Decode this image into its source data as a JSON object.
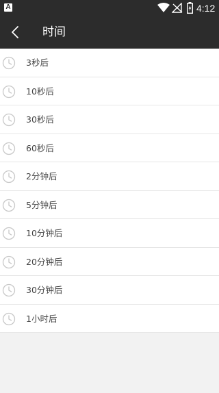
{
  "status_bar": {
    "app_badge_letter": "A",
    "time": "4:12",
    "icons": [
      "wifi-icon",
      "no-signal-icon",
      "battery-charging-icon"
    ]
  },
  "toolbar": {
    "back_icon": "chevron-left-icon",
    "title": "时间"
  },
  "time_options": [
    {
      "label": "3秒后"
    },
    {
      "label": "10秒后"
    },
    {
      "label": "30秒后"
    },
    {
      "label": "60秒后"
    },
    {
      "label": "2分钟后"
    },
    {
      "label": "5分钟后"
    },
    {
      "label": "10分钟后"
    },
    {
      "label": "20分钟后"
    },
    {
      "label": "30分钟后"
    },
    {
      "label": "1小时后"
    }
  ],
  "colors": {
    "toolbar_bg": "#2c2c2c",
    "page_bg": "#f2f2f2",
    "row_bg": "#ffffff",
    "icon": "#c8c8c8"
  }
}
